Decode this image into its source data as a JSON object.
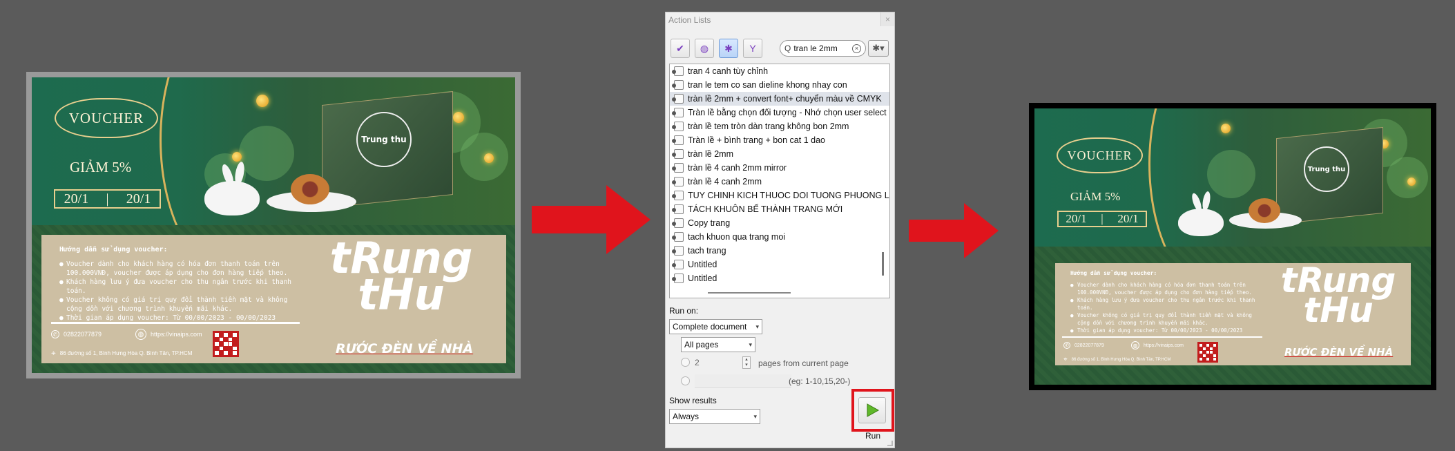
{
  "dialog": {
    "title": "Action Lists",
    "close_glyph": "×",
    "search_value": "tran le 2mm",
    "search_icon_glyph": "Q",
    "clear_glyph": "×",
    "toolbar_icons": [
      "checkmark-icon",
      "globe-icon",
      "gear-icon",
      "funnel-icon"
    ],
    "toolbar_glyphs": [
      "✔",
      "◍",
      "✱",
      "Y"
    ],
    "settings_glyph": "✱▾",
    "actions": [
      "tran 4 canh tùy chỉnh",
      "tran le tem co san dieline khong nhay con",
      "tràn lề 2mm + convert font+ chuyển màu về CMYK",
      "Tràn lề bằng chọn đối tượng - Nhớ chọn user select",
      "tràn lề tem tròn  dàn trang không bon 2mm",
      "Tràn lề + bình trang + bon cat 1 dao",
      "tràn lề 2mm",
      "tràn lề 4 canh 2mm mirror",
      "tràn lề 4 canh 2mm",
      "TUY CHINH KICH THUOC DOI TUONG PHUONG LE",
      "TÁCH KHUÔN BẾ THÀNH TRANG MỚI",
      "Copy trang",
      "tach khuon qua trang moi",
      "tach trang",
      "Untitled",
      "Untitled"
    ],
    "selected_index": 2,
    "run_on_label": "Run on:",
    "run_on_value": "Complete document",
    "pages_value": "All pages",
    "pages_count": "2",
    "pages_from_label": "pages from current page",
    "range_example": "(eg: 1-10,15,20-)",
    "show_results_label": "Show results",
    "show_results_value": "Always",
    "run_label": "Run",
    "dropdown_glyph": "▾"
  },
  "voucher": {
    "title": "VOUCHER",
    "discount": "GIẢM 5%",
    "date_from": "20/1",
    "date_sep": "|",
    "date_to": "20/1",
    "brand_small": "Trung thu",
    "guide_title": "Hướng dẫn sử dụng voucher:",
    "guide_items": [
      "Voucher dành cho khách hàng có hóa đơn thanh toán trên 100.000VNĐ, voucher được áp dụng cho đơn hàng tiếp theo.",
      "Khách hàng lưu ý đưa voucher cho thu ngân trước khi thanh toán.",
      "Voucher không có giá trị quy đổi thành tiền mặt và không cộng dồn với chương trình khuyến mãi khác.",
      "Thời gian áp dụng voucher: Từ 00/00/2023 - 00/00/2023"
    ],
    "phone": "02822077879",
    "website": "https://vinaips.com",
    "address": "86 đường số 1, Bình Hưng Hòa Q. Bình Tân, TP.HCM",
    "big_line1": "tRung",
    "big_line2": "tHu",
    "tagline": "RƯỚC ĐÈN VỀ NHÀ"
  },
  "colors": {
    "arrow": "#e0141c",
    "highlight": "#e0141c",
    "voucher_green": "#1f6a4c",
    "gold": "#d9b35c"
  }
}
